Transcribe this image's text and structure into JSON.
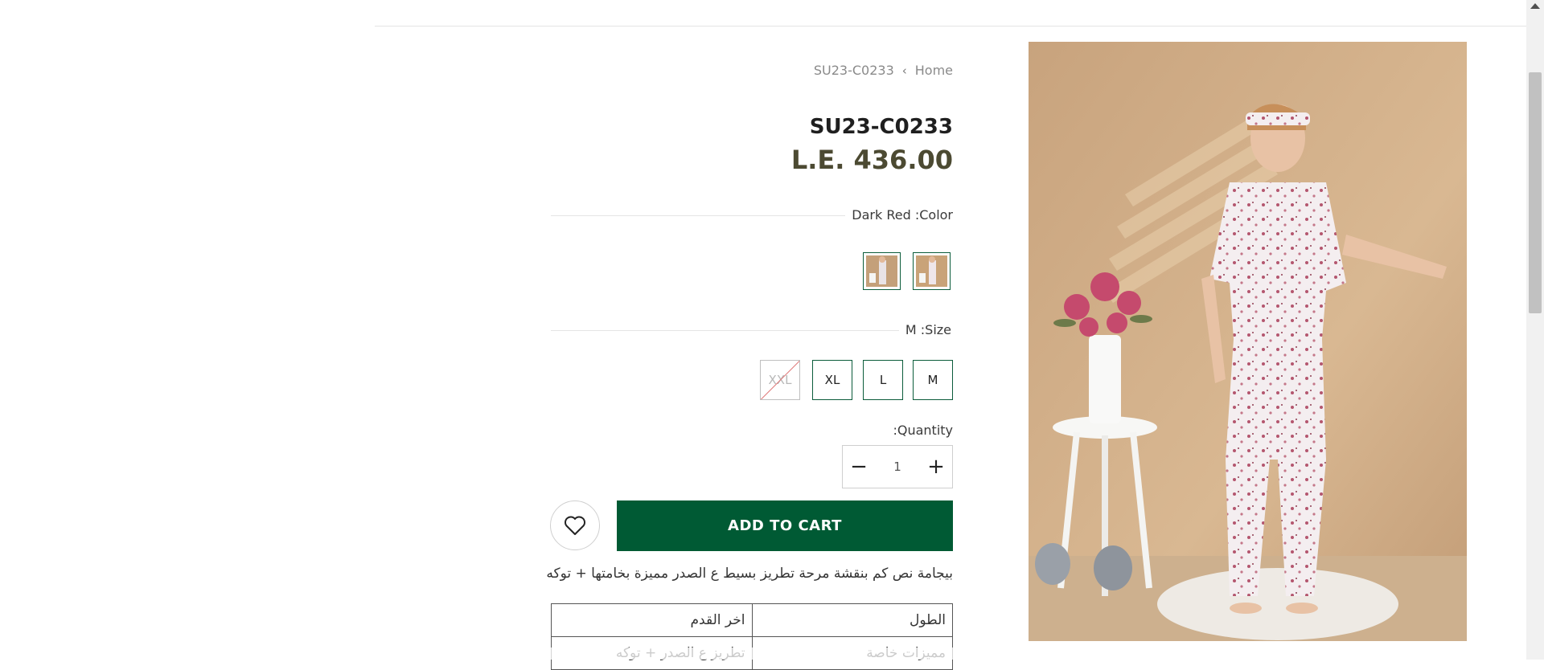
{
  "breadcrumb": {
    "current": "SU23-C0233",
    "home": "Home"
  },
  "product": {
    "title": "SU23-C0233",
    "price": "L.E. 436.00",
    "description": "بيجامة نص كم  بنقشة مرحة  تطريز بسيط ع الصدر  مميزة بخامتها + توكه"
  },
  "color_option": {
    "label": "Dark Red :Color",
    "swatches": [
      {
        "name": "swatch-1-icon"
      },
      {
        "name": "swatch-2-icon"
      }
    ]
  },
  "size_option": {
    "label": "M :Size",
    "sizes": [
      {
        "label": "M",
        "available": true
      },
      {
        "label": "L",
        "available": true
      },
      {
        "label": "XL",
        "available": true
      },
      {
        "label": "XXL",
        "available": false
      }
    ]
  },
  "quantity": {
    "label": ":Quantity",
    "value": "1",
    "minus": "−",
    "plus": "+"
  },
  "actions": {
    "add_to_cart": "ADD TO CART"
  },
  "spec_table": {
    "rows": [
      [
        "الطول",
        "اخر القدم"
      ],
      [
        "مميزات خاصة",
        "تطريز ع الصدر  + توكه"
      ]
    ]
  },
  "colors": {
    "brand": "#005a34",
    "price": "#4c4a32",
    "border": "#0b5c3b"
  }
}
